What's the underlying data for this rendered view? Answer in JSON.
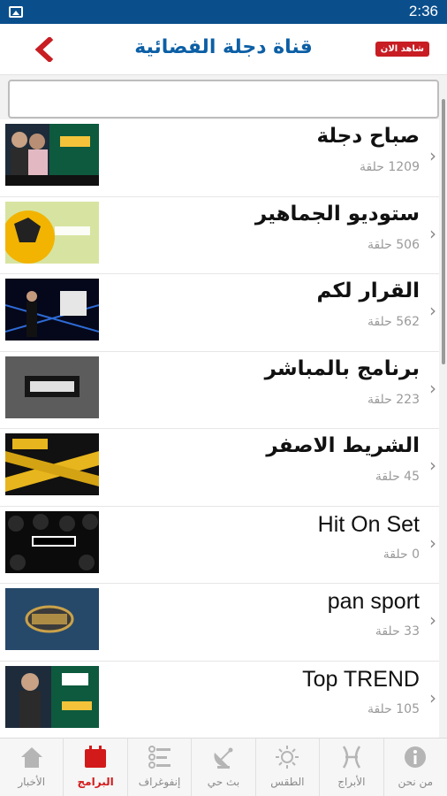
{
  "status_bar": {
    "time": "2:36"
  },
  "header": {
    "title": "قناة دجلة الفضائية",
    "watch_now_label": "شاهد الان"
  },
  "search": {
    "value": "",
    "placeholder": ""
  },
  "programs": [
    {
      "name": "صباح دجلة",
      "count": "1209 حلقة",
      "thumb": "sabah-dijla"
    },
    {
      "name": "ستوديو الجماهير",
      "count": "506 حلقة",
      "thumb": "football"
    },
    {
      "name": "القرار لكم",
      "count": "562 حلقة",
      "thumb": "qarar"
    },
    {
      "name": "برنامج بالمباشر",
      "count": "223 حلقة",
      "thumb": "mubashir"
    },
    {
      "name": "الشريط الاصفر",
      "count": "45 حلقة",
      "thumb": "yellow-tape"
    },
    {
      "name": "Hit On Set",
      "count": "0 حلقة",
      "thumb": "hit-on-set"
    },
    {
      "name": "pan sport",
      "count": "33 حلقة",
      "thumb": "pan-sport"
    },
    {
      "name": "Top TREND",
      "count": "105 حلقة",
      "thumb": "top-trend"
    }
  ],
  "bottom_nav": [
    {
      "label": "الأخبار",
      "icon": "home-icon",
      "active": false
    },
    {
      "label": "البرامج",
      "icon": "calendar-icon",
      "active": true
    },
    {
      "label": "إنفوغراف",
      "icon": "infograph-icon",
      "active": false
    },
    {
      "label": "بث حي",
      "icon": "satellite-dish-icon",
      "active": false
    },
    {
      "label": "الطقس",
      "icon": "sun-icon",
      "active": false
    },
    {
      "label": "الأبراج",
      "icon": "pisces-icon",
      "active": false
    },
    {
      "label": "من نحن",
      "icon": "info-icon",
      "active": false
    }
  ],
  "colors": {
    "status_bar": "#0a4f8c",
    "title": "#0c5fa5",
    "accent_red": "#c81d23"
  }
}
